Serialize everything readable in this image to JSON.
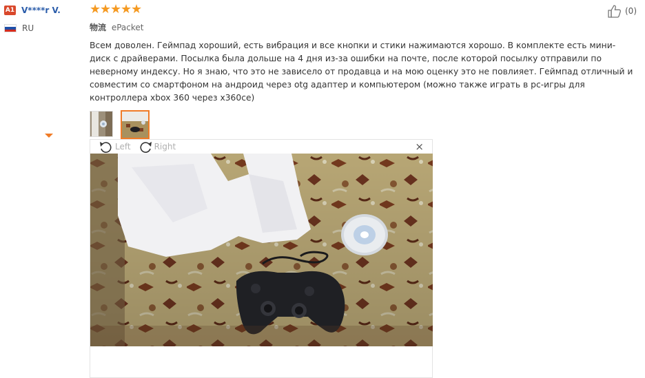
{
  "reviewer": {
    "level": "A1",
    "name": "V****r V.",
    "country_code": "RU",
    "flag_colors": [
      "#ffffff",
      "#1f4fa8",
      "#d52b1e"
    ]
  },
  "rating": {
    "stars": 5,
    "max": 5,
    "color": "#f59a22"
  },
  "shipping": {
    "label": "物流",
    "method": "ePacket"
  },
  "review_text": "Всем доволен. Геймпад хороший, есть вибрация и все кнопки и стики нажимаются хорошо. В комплекте есть мини-диск с драйверами. Посылка была дольше на 4 дня из-за ошибки на почте, после которой посылку отправили по неверному индексу. Но я знаю, что это не зависело от продавца и на мою оценку это не повлияет. Геймпад отличный и совместим со смартфоном на андроид через otg адаптер и компьютером (можно также играть в pc-игры для контроллера xbox 360 через x360ce)",
  "helpful": {
    "count": "(0)",
    "icon": "thumbs-up-icon"
  },
  "thumbnails": [
    {
      "name": "thumbnail-1",
      "active": false
    },
    {
      "name": "thumbnail-2",
      "active": true
    }
  ],
  "viewer": {
    "rotate_left_label": "Left",
    "rotate_right_label": "Right",
    "close_label": "×",
    "accent": "#f07b26"
  }
}
